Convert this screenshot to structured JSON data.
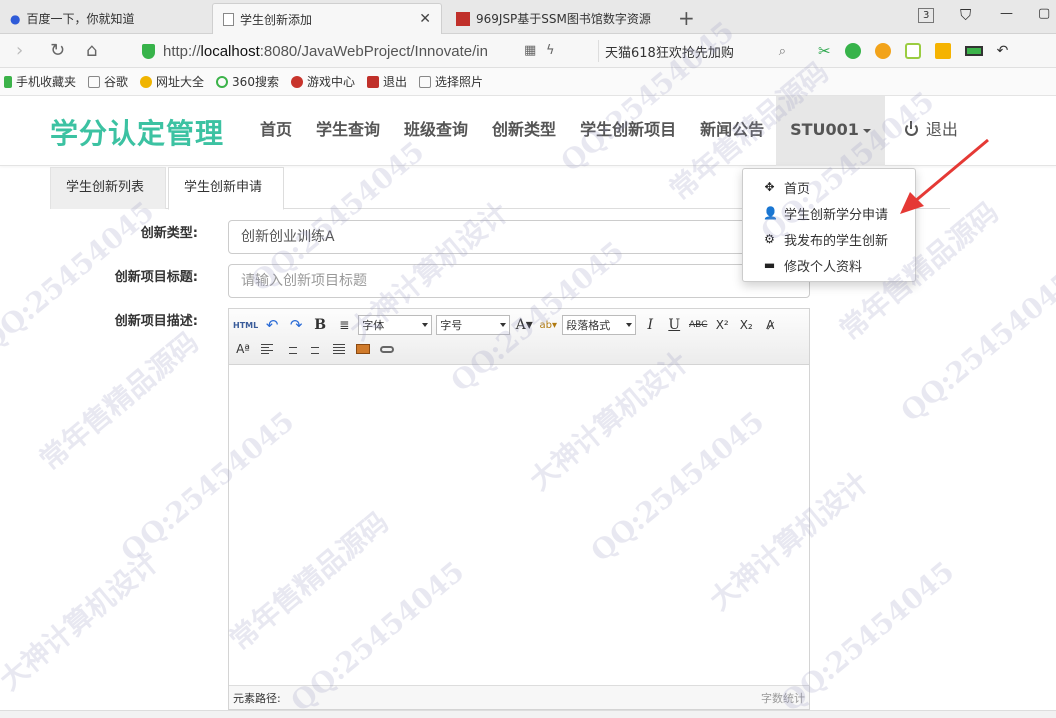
{
  "browser": {
    "tabs": [
      {
        "title": "百度一下，你就知道",
        "icon": "paw-icon"
      },
      {
        "title": "学生创新添加",
        "icon": "page-icon",
        "active": true
      },
      {
        "title": "969JSP基于SSM图书馆数字资源",
        "icon": "red-favicon"
      }
    ],
    "tab_count": "3",
    "url_prefix": "http://",
    "url_host": "localhost",
    "url_rest": ":8080/JavaWebProject/Innovate/in",
    "search_text": "天猫618狂欢抢先加购",
    "bookmarks": [
      "手机收藏夹",
      "谷歌",
      "网址大全",
      "360搜索",
      "游戏中心",
      "退出",
      "选择照片"
    ]
  },
  "site": {
    "brand": "学分认定管理",
    "nav": [
      "首页",
      "学生查询",
      "班级查询",
      "创新类型",
      "学生创新项目",
      "新闻公告"
    ],
    "user": "STU001",
    "logout": "退出",
    "accent": "#3cc2a2"
  },
  "dropdown": [
    {
      "label": "首页",
      "icon": "move-icon"
    },
    {
      "label": "学生创新学分申请",
      "icon": "user-icon"
    },
    {
      "label": "我发布的学生创新",
      "icon": "gear-icon"
    },
    {
      "label": "修改个人资料",
      "icon": "card-icon"
    }
  ],
  "content_tabs": [
    "学生创新列表",
    "学生创新申请"
  ],
  "form": {
    "type_label": "创新类型:",
    "type_value": "创新创业训练A",
    "title_label": "创新项目标题:",
    "title_placeholder": "请输入创新项目标题",
    "desc_label": "创新项目描述:"
  },
  "editor": {
    "font_select": "字体",
    "size_select": "字号",
    "format_select": "段落格式",
    "html_btn": "HTML",
    "path_label": "元素路径:",
    "word_count": "字数统计"
  },
  "watermark": [
    "QQ:25454045",
    "常年售精品源码",
    "大神计算机设计"
  ]
}
